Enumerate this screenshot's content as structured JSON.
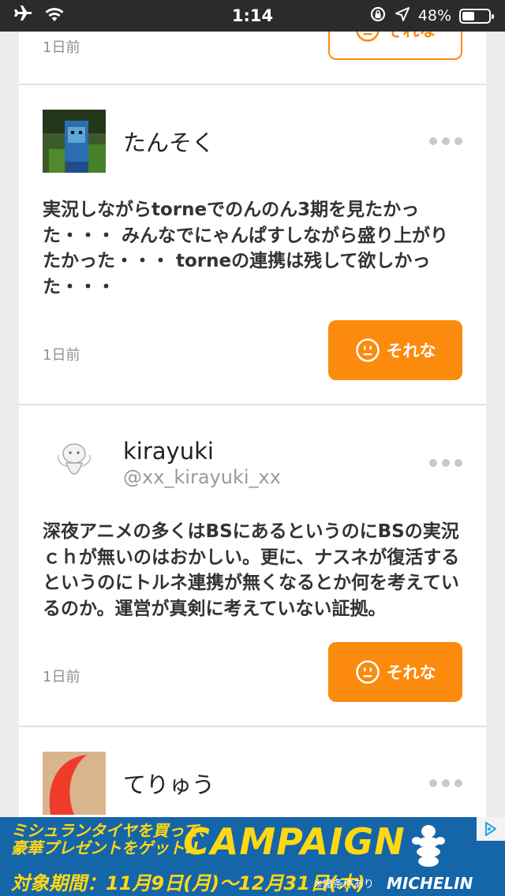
{
  "status_bar": {
    "time": "1:14",
    "battery": "48%",
    "battery_level": 0.48
  },
  "posts": [
    {
      "time": "1日前",
      "reaction_label": "それな"
    },
    {
      "username": "たんそく",
      "body": "実況しながらtorneでのんのん3期を見たかった・・・ みんなでにゃんぱすしながら盛り上がりたかった・・・ torneの連携は残して欲しかった・・・",
      "time": "1日前",
      "reaction_label": "それな"
    },
    {
      "username": "kirayuki",
      "handle": "@xx_kirayuki_xx",
      "body": "深夜アニメの多くはBSにあるというのにBSの実況ｃｈが無いのはおかしい。更に、ナスネが復活するというのにトルネ連携が無くなるとか何を考えているのか。運営が真剣に考えていない証拠。",
      "time": "1日前",
      "reaction_label": "それな"
    },
    {
      "username": "てりゅう"
    }
  ],
  "ad": {
    "line1": "ミシュランタイヤを買って、",
    "line2": "豪華プレゼントをゲット!!",
    "headline": "CAMPAIGN",
    "period": "対象期間：11月9日(月)〜12月31日(木)",
    "note": "※諸条件あり",
    "brand": "MICHELIN"
  },
  "colors": {
    "accent": "#fb8a0d",
    "ad_bg": "#1565a9",
    "ad_yellow": "#ffd814"
  }
}
